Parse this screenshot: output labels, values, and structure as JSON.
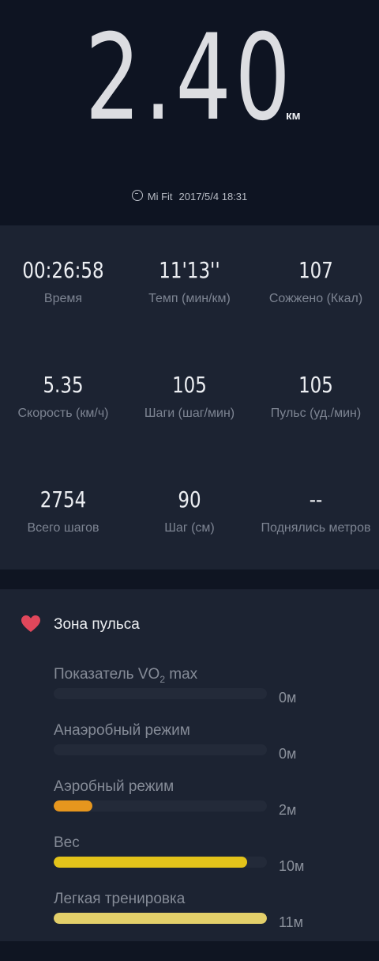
{
  "workout": {
    "distance": "2.40",
    "distance_unit": "км",
    "source_icon": "mi-logo-icon",
    "source_name": "Mi Fit",
    "datetime": "2017/5/4 18:31"
  },
  "stats": [
    {
      "value": "00:26:58",
      "label": "Время"
    },
    {
      "value": "11'13''",
      "label": "Темп (мин/км)"
    },
    {
      "value": "107",
      "label": "Сожжено (Ккал)"
    },
    {
      "value": "5.35",
      "label": "Скорость (км/ч)"
    },
    {
      "value": "105",
      "label": "Шаги (шаг/мин)"
    },
    {
      "value": "105",
      "label": "Пульс (уд./мин)"
    },
    {
      "value": "2754",
      "label": "Всего шагов"
    },
    {
      "value": "90",
      "label": "Шаг (см)"
    },
    {
      "value": "--",
      "label": "Поднялись метров"
    }
  ],
  "heart_zones": {
    "title": "Зона пульса",
    "icon": "heart-icon",
    "icon_color": "#e0475b",
    "zones": [
      {
        "label_main": "Показатель VO",
        "label_sub": "2",
        "label_tail": " max",
        "time": "0м",
        "minutes": 0,
        "color": "#6b2f3a"
      },
      {
        "label_main": "Анаэробный режим",
        "time": "0м",
        "minutes": 0,
        "color": "#8a3b2e"
      },
      {
        "label_main": "Аэробный режим",
        "time": "2м",
        "minutes": 2,
        "color": "#e6961e"
      },
      {
        "label_main": "Вес",
        "time": "10м",
        "minutes": 10,
        "color": "#e3c31a"
      },
      {
        "label_main": "Легкая тренировка",
        "time": "11м",
        "minutes": 11,
        "color": "#e3cf6a"
      }
    ]
  }
}
